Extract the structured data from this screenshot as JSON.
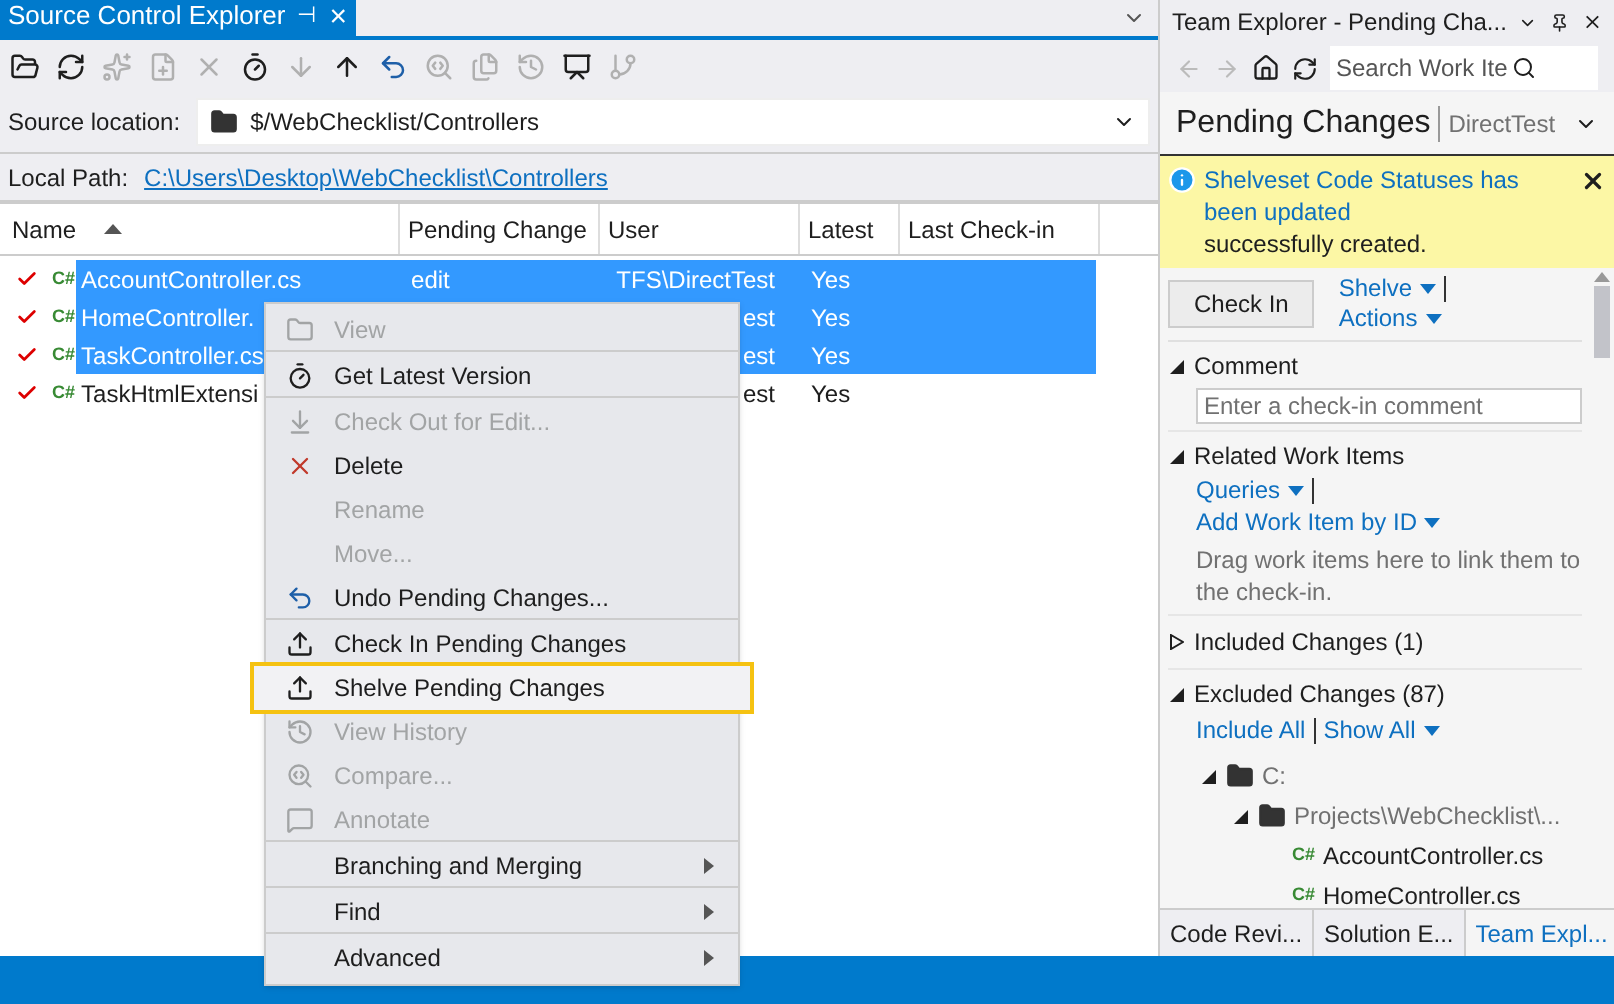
{
  "left_panel": {
    "tab": {
      "label": "Source Control Explorer",
      "pin": "⊣",
      "close": "×",
      "selected": true
    },
    "toolbar": [
      {
        "disabled": false
      },
      {
        "disabled": false
      },
      {
        "disabled": true
      },
      {
        "disabled": true
      },
      {
        "disabled": true
      },
      {
        "disabled": false
      },
      {
        "disabled": true
      },
      {
        "disabled": false
      },
      {
        "disabled": false
      },
      {
        "disabled": true
      },
      {
        "disabled": true
      },
      {
        "disabled": true
      },
      {
        "disabled": false
      },
      {
        "disabled": true
      }
    ],
    "source_location": {
      "label": "Source location:",
      "value": "$/WebChecklist/Controllers"
    },
    "local_path": {
      "label": "Local Path:",
      "link": "C:\\Users\\Desktop\\WebChecklist\\Controllers"
    },
    "table": {
      "columns": [
        "Name",
        "Pending Change",
        "User",
        "Latest",
        "Last Check-in"
      ],
      "rows": [
        {
          "icon": "C#",
          "name": "AccountController.cs",
          "pending": "edit",
          "user": "TFS\\DirectTest",
          "latest": "Yes",
          "selected": true
        },
        {
          "icon": "C#",
          "name": "HomeController.",
          "pending": "",
          "user": "est",
          "latest": "Yes",
          "selected": true
        },
        {
          "icon": "C#",
          "name": "TaskController.cs",
          "pending": "",
          "user": "est",
          "latest": "Yes",
          "selected": true
        },
        {
          "icon": "C#",
          "name": "TaskHtmlExtensi",
          "pending": "",
          "user": "est",
          "latest": "Yes",
          "selected": false
        }
      ]
    }
  },
  "context_menu": [
    {
      "label": "View",
      "disabled": true,
      "selected": false,
      "submenu": false,
      "separator_after": true
    },
    {
      "label": "Get Latest Version",
      "disabled": false,
      "selected": false,
      "submenu": false,
      "separator_after": true
    },
    {
      "label": "Check Out for Edit...",
      "disabled": true,
      "selected": false,
      "submenu": false,
      "separator_after": false
    },
    {
      "label": "Delete",
      "disabled": false,
      "selected": false,
      "submenu": false,
      "separator_after": false
    },
    {
      "label": "Rename",
      "disabled": true,
      "selected": false,
      "submenu": false,
      "separator_after": false
    },
    {
      "label": "Move...",
      "disabled": true,
      "selected": false,
      "submenu": false,
      "separator_after": false
    },
    {
      "label": "Undo Pending Changes...",
      "disabled": false,
      "selected": false,
      "submenu": false,
      "separator_after": true
    },
    {
      "label": "Check In Pending Changes",
      "disabled": false,
      "selected": false,
      "submenu": false,
      "separator_after": false
    },
    {
      "label": "Shelve Pending Changes",
      "disabled": false,
      "selected": true,
      "submenu": false,
      "separator_after": false
    },
    {
      "label": "View History",
      "disabled": true,
      "selected": false,
      "submenu": false,
      "separator_after": false
    },
    {
      "label": "Compare...",
      "disabled": true,
      "selected": false,
      "submenu": false,
      "separator_after": false
    },
    {
      "label": "Annotate",
      "disabled": true,
      "selected": false,
      "submenu": false,
      "separator_after": true
    },
    {
      "label": "Branching and Merging",
      "disabled": false,
      "selected": false,
      "submenu": true,
      "separator_after": true
    },
    {
      "label": "Find",
      "disabled": false,
      "selected": false,
      "submenu": true,
      "separator_after": true
    },
    {
      "label": "Advanced",
      "disabled": false,
      "selected": false,
      "submenu": true,
      "separator_after": false
    }
  ],
  "team_explorer": {
    "title": "Team Explorer - Pending Cha...",
    "search": {
      "placeholder": "Search Work Ite"
    },
    "header": {
      "title": "Pending Changes",
      "context": "DirectTest"
    },
    "notification": {
      "link": "Shelveset Code Statuses has been updated",
      "text": "successfully created."
    },
    "check_in_button": "Check In",
    "actions": [
      {
        "label": "Shelve"
      },
      {
        "label": "Actions"
      }
    ],
    "sections": [
      {
        "title": "Comment",
        "expanded": true,
        "kind": "comment",
        "placeholder": "Enter a check-in comment"
      },
      {
        "title": "Related Work Items",
        "expanded": true,
        "kind": "work_items",
        "links": [
          "Queries",
          "Add Work Item by ID"
        ],
        "hint": "Drag work items here to link them to the check-in."
      },
      {
        "title": "Included Changes (1)",
        "expanded": false,
        "kind": "plain"
      },
      {
        "title": "Excluded Changes (87)",
        "expanded": true,
        "kind": "changes",
        "links": [
          "Include All",
          "Show All"
        ],
        "tree": [
          {
            "label": "C:",
            "expanded": true,
            "children": [
              {
                "label": "Projects\\WebChecklist\\...",
                "expanded": true,
                "children": [
                  {
                    "icon": "C#",
                    "label": "AccountController.cs"
                  },
                  {
                    "icon": "C#",
                    "label": "HomeController.cs"
                  }
                ]
              }
            ]
          }
        ]
      }
    ],
    "bottom_tabs": [
      {
        "label": "Code Revi...",
        "selected": false
      },
      {
        "label": "Solution E...",
        "selected": false
      },
      {
        "label": "Team Expl...",
        "selected": true
      }
    ]
  }
}
